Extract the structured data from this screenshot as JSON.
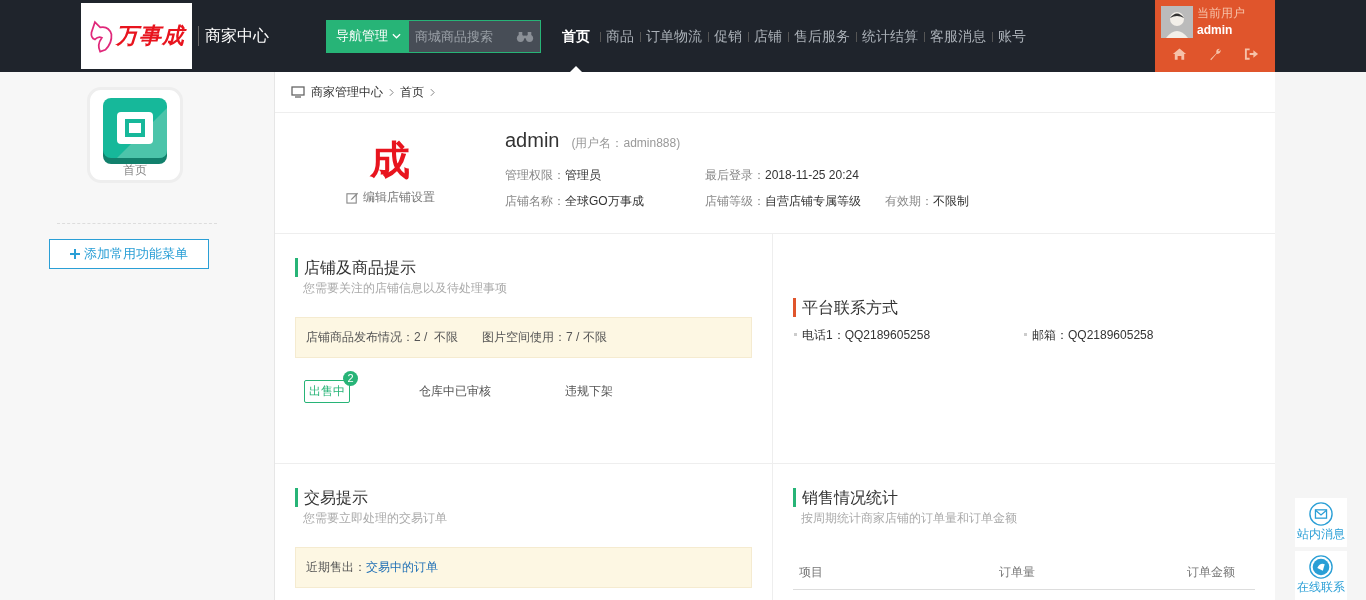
{
  "header": {
    "logo_text": "万事成",
    "title": "商家中心",
    "nav_button": "导航管理",
    "search": {
      "placeholder": "商城商品搜索"
    },
    "nav": [
      {
        "label": "首页",
        "selected": true
      },
      {
        "label": "商品",
        "selected": false
      },
      {
        "label": "订单物流",
        "selected": false
      },
      {
        "label": "促销",
        "selected": false
      },
      {
        "label": "店铺",
        "selected": false
      },
      {
        "label": "售后服务",
        "selected": false
      },
      {
        "label": "统计结算",
        "selected": false
      },
      {
        "label": "客服消息",
        "selected": false
      },
      {
        "label": "账号",
        "selected": false
      }
    ],
    "user": {
      "label": "当前用户",
      "name": "admin"
    }
  },
  "sidebar": {
    "tile": "首页",
    "add_button": "添加常用功能菜单"
  },
  "breadcrumb": [
    "商家管理中心",
    "首页"
  ],
  "profile": {
    "avatar_text": "成",
    "edit_link": "编辑店铺设置",
    "name": "admin",
    "username": "(用户名：admin888)",
    "rows": [
      [
        {
          "label": "管理权限：",
          "value": "管理员"
        },
        {
          "label": "最后登录：",
          "value": "2018-11-25 20:24"
        }
      ],
      [
        {
          "label": "店铺名称：",
          "value": "全球GO万事成"
        },
        {
          "label": "店铺等级：",
          "value": "自营店铺专属等级"
        },
        {
          "label": "有效期：",
          "value": "不限制"
        }
      ]
    ]
  },
  "shop_tips": {
    "title": "店铺及商品提示",
    "subtitle": "您需要关注的店铺信息以及待处理事项",
    "notices": [
      "店铺商品发布情况：2 /  不限",
      "图片空间使用：7 / 不限"
    ],
    "tabs": [
      {
        "label": "出售中",
        "selected": true,
        "badge": "2"
      },
      {
        "label": "仓库中已审核",
        "selected": false
      },
      {
        "label": "违规下架",
        "selected": false
      }
    ]
  },
  "contact": {
    "title": "平台联系方式",
    "items": [
      "电话1：QQ2189605258",
      "邮箱：QQ2189605258"
    ]
  },
  "trade": {
    "title": "交易提示",
    "subtitle": "您需要立即处理的交易订单",
    "notice_label": "近期售出：",
    "notice_link": "交易中的订单"
  },
  "sales": {
    "title": "销售情况统计",
    "subtitle": "按周期统计商家店铺的订单量和订单金额",
    "columns": [
      "项目",
      "订单量",
      "订单金额"
    ]
  },
  "float_buttons": [
    "站内消息",
    "在线联系"
  ]
}
